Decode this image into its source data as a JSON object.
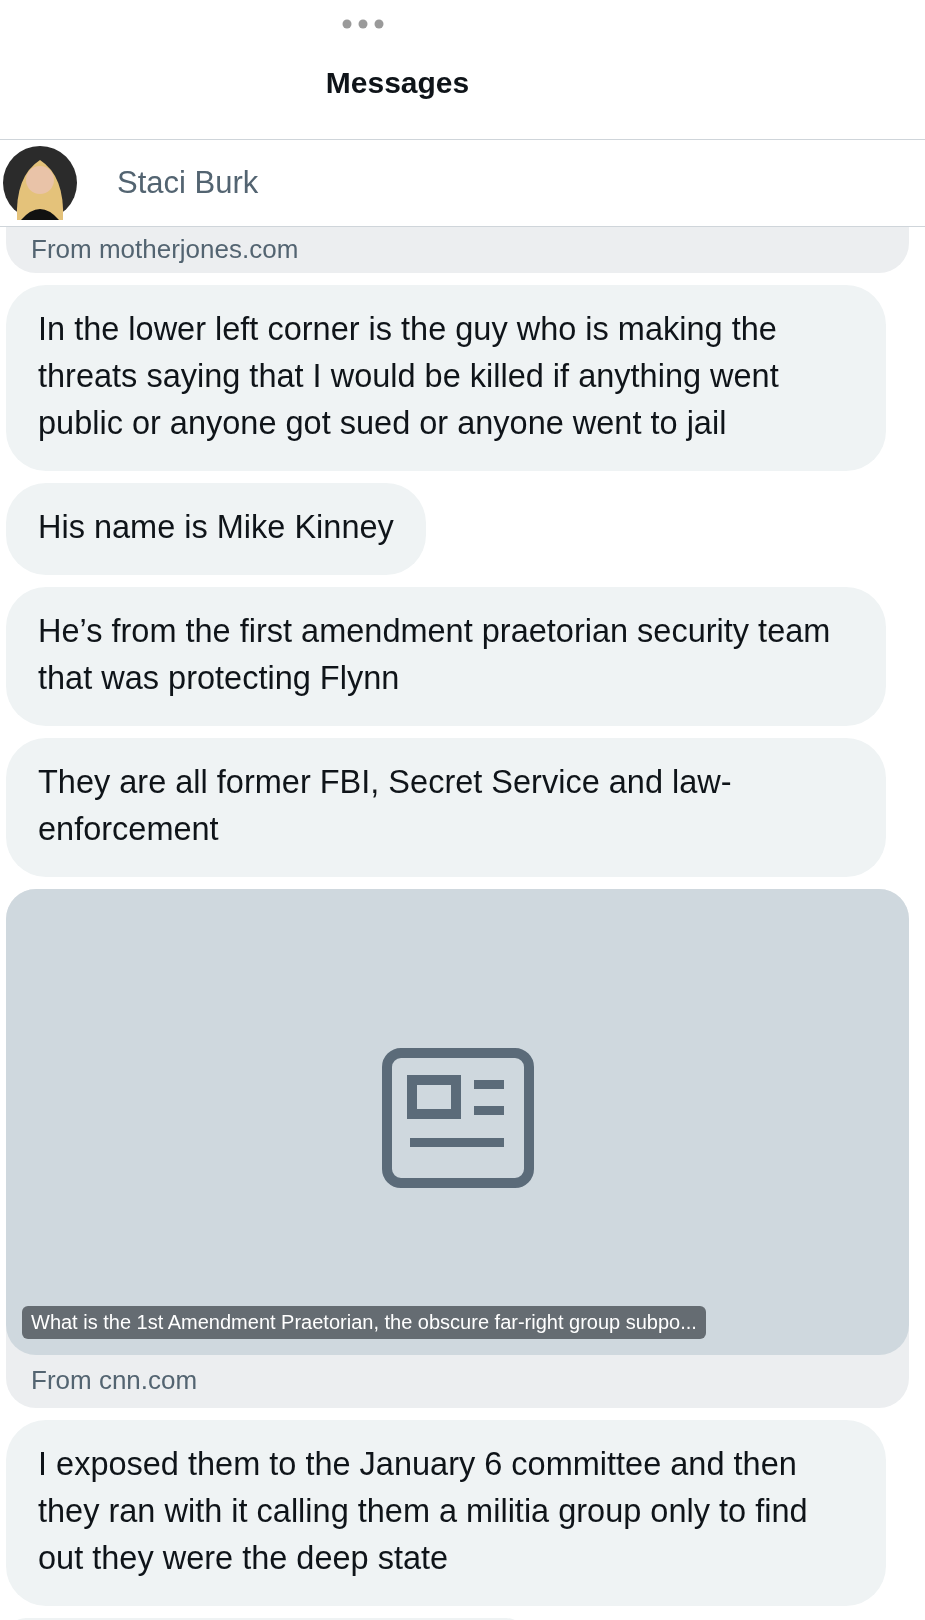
{
  "header": {
    "title": "Messages"
  },
  "contact": {
    "name": "Staci Burk"
  },
  "messages": [
    {
      "kind": "link_end",
      "source": "From motherjones.com"
    },
    {
      "kind": "text",
      "text": "In the lower left corner is the guy who is making the threats saying that I would be killed if anything went public or anyone got sued or anyone went to jail"
    },
    {
      "kind": "text",
      "text": "His name is Mike Kinney"
    },
    {
      "kind": "text",
      "text": "He’s from the first amendment praetorian security team that was protecting Flynn"
    },
    {
      "kind": "text",
      "text": "They are all former FBI, Secret Service and law-enforcement"
    },
    {
      "kind": "link",
      "caption": "What is the 1st Amendment Praetorian, the obscure far-right group subpo...",
      "source": "From cnn.com"
    },
    {
      "kind": "text",
      "text": "I exposed them to the January 6 committee and then they ran with it calling them a militia group only to find out they were the deep state"
    }
  ]
}
